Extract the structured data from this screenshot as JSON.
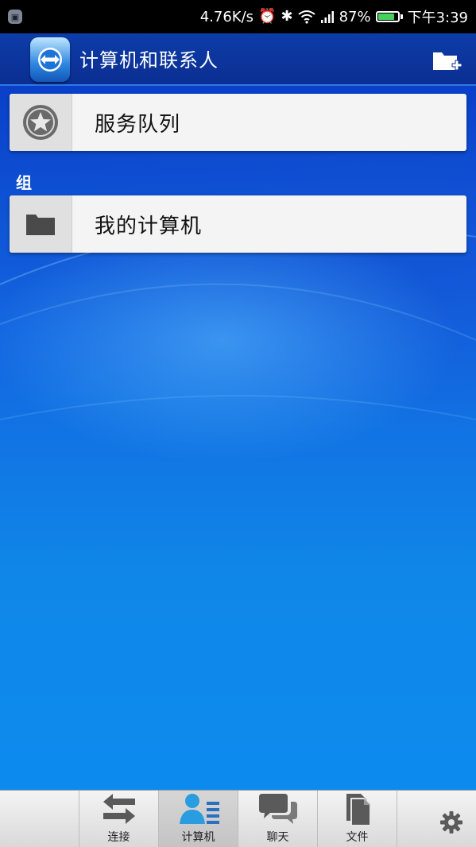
{
  "status_bar": {
    "network_speed": "4.76K/s",
    "battery_percent": "87%",
    "battery_level": 0.87,
    "time": "下午3:39",
    "icons": [
      "notification-icon",
      "alarm-icon",
      "bluetooth-icon",
      "wifi-icon",
      "signal-icon",
      "battery-icon"
    ]
  },
  "header": {
    "title": "计算机和联系人",
    "logo": "teamviewer-logo",
    "action_icon": "add-folder-icon"
  },
  "list": {
    "service_queue": {
      "label": "服务队列",
      "icon": "star-badge-icon"
    },
    "group_section_label": "组",
    "groups": [
      {
        "label": "我的计算机",
        "icon": "folder-icon"
      }
    ]
  },
  "tabs": [
    {
      "label": "连接",
      "icon": "swap-arrows-icon",
      "active": false
    },
    {
      "label": "计算机",
      "icon": "contacts-icon",
      "active": true
    },
    {
      "label": "聊天",
      "icon": "chat-bubbles-icon",
      "active": false
    },
    {
      "label": "文件",
      "icon": "documents-icon",
      "active": false
    }
  ],
  "settings_icon": "gear-icon",
  "colors": {
    "header_bg": "#0b2e92",
    "card_bg": "#f4f4f4",
    "background": "#0a6be0"
  }
}
